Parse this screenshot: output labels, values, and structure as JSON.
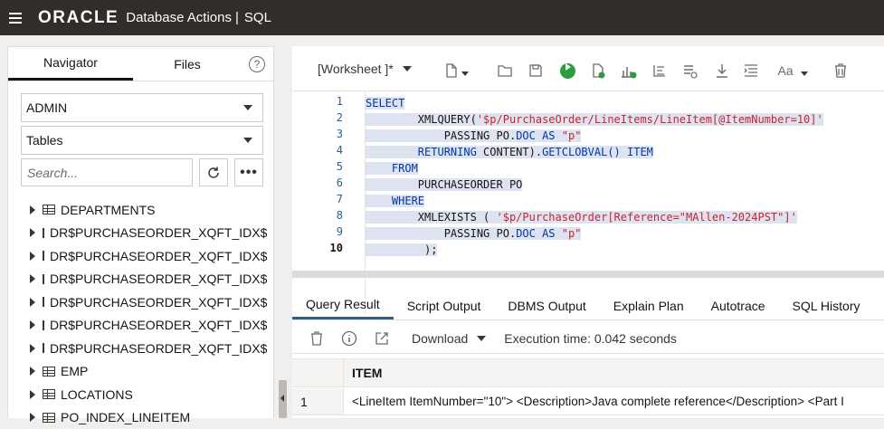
{
  "header": {
    "logo": "ORACLE",
    "app_name": "Database Actions",
    "separator": "|",
    "module": "SQL"
  },
  "navigator": {
    "tabs": [
      "Navigator",
      "Files"
    ],
    "schema": "ADMIN",
    "object_type": "Tables",
    "search_placeholder": "Search...",
    "items": [
      "DEPARTMENTS",
      "DR$PURCHASEORDER_XQFT_IDX$",
      "DR$PURCHASEORDER_XQFT_IDX$",
      "DR$PURCHASEORDER_XQFT_IDX$",
      "DR$PURCHASEORDER_XQFT_IDX$",
      "DR$PURCHASEORDER_XQFT_IDX$",
      "DR$PURCHASEORDER_XQFT_IDX$",
      "EMP",
      "LOCATIONS",
      "PO_INDEX_LINEITEM"
    ]
  },
  "toolbar": {
    "worksheet_label": "[Worksheet ]*",
    "icons": [
      "new-icon",
      "open-icon",
      "save-icon",
      "run-icon",
      "run-script-icon",
      "explain-plan-icon",
      "autotrace-icon",
      "sql-history-icon",
      "download-icon",
      "format-icon",
      "text-case-icon",
      "clear-icon"
    ]
  },
  "editor": {
    "line_numbers": [
      "1",
      "2",
      "3",
      "4",
      "5",
      "6",
      "7",
      "8",
      "9",
      "10"
    ],
    "lines": [
      {
        "indent": "",
        "tokens": [
          {
            "t": "SELECT",
            "c": "kw"
          }
        ]
      },
      {
        "indent": "        ",
        "tokens": [
          {
            "t": "XMLQUERY(",
            "c": "pl"
          },
          {
            "t": "'$p/PurchaseOrder/LineItems/LineItem[@ItemNumber=10]'",
            "c": "str"
          }
        ]
      },
      {
        "indent": "            ",
        "tokens": [
          {
            "t": "PASSING PO.",
            "c": "pl"
          },
          {
            "t": "DOC AS ",
            "c": "kw"
          },
          {
            "t": "\"p\"",
            "c": "str"
          }
        ]
      },
      {
        "indent": "        ",
        "tokens": [
          {
            "t": "RETURNING ",
            "c": "kw"
          },
          {
            "t": "CONTENT).",
            "c": "pl"
          },
          {
            "t": "GETCLOBVAL() ITEM",
            "c": "kw"
          }
        ]
      },
      {
        "indent": "    ",
        "tokens": [
          {
            "t": "FROM",
            "c": "kw"
          }
        ]
      },
      {
        "indent": "        ",
        "tokens": [
          {
            "t": "PURCHASEORDER PO",
            "c": "pl"
          }
        ]
      },
      {
        "indent": "    ",
        "tokens": [
          {
            "t": "WHERE",
            "c": "kw"
          }
        ]
      },
      {
        "indent": "        ",
        "tokens": [
          {
            "t": "XMLEXISTS ( ",
            "c": "pl"
          },
          {
            "t": "'$p/PurchaseOrder[Reference=\"MAllen-2024PST\"]'",
            "c": "str"
          }
        ]
      },
      {
        "indent": "            ",
        "tokens": [
          {
            "t": "PASSING PO.",
            "c": "pl"
          },
          {
            "t": "DOC AS ",
            "c": "kw"
          },
          {
            "t": "\"p\"",
            "c": "str"
          }
        ]
      },
      {
        "indent": "         ",
        "tokens": [
          {
            "t": ");",
            "c": "pl"
          }
        ]
      }
    ]
  },
  "results": {
    "tabs": [
      "Query Result",
      "Script Output",
      "DBMS Output",
      "Explain Plan",
      "Autotrace",
      "SQL History"
    ],
    "download_label": "Download",
    "execution_time": "Execution time: 0.042 seconds",
    "columns": [
      "ITEM"
    ],
    "rows": [
      {
        "num": "1",
        "item": "<LineItem ItemNumber=\"10\"> <Description>Java complete reference</Description> <Part I"
      }
    ]
  }
}
